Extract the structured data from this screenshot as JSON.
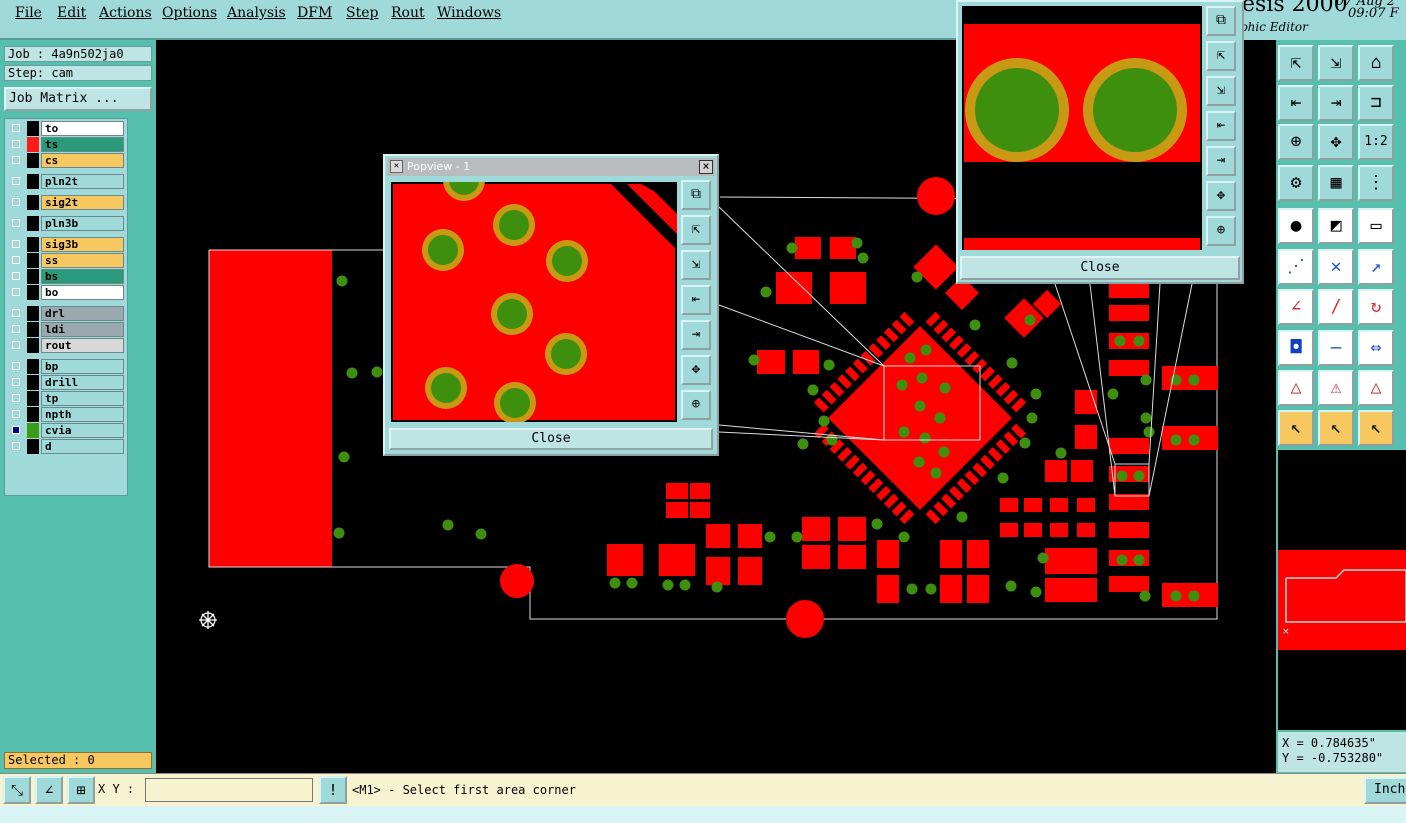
{
  "menubar": {
    "items": [
      "File",
      "Edit",
      "Actions",
      "Options",
      "Analysis",
      "DFM",
      "Step",
      "Rout",
      "Windows"
    ]
  },
  "header": {
    "app_title_fragment": "esis 2000",
    "subtitle_fragment": "phic Editor",
    "date_fragment": "07 Aug 2",
    "time_fragment": "09:07 F"
  },
  "job": {
    "job_line": "Job : 4a9n502ja0",
    "step_line": "Step: cam",
    "matrix_button": "Job Matrix ..."
  },
  "layers": [
    {
      "name": "to",
      "color": "#ffffff",
      "swatch": "#000000"
    },
    {
      "name": "ts",
      "color": "#2a9a7a",
      "swatch": "#ff1a1a"
    },
    {
      "name": "cs",
      "color": "#f7c860",
      "swatch": "#000000"
    },
    {
      "name": "pln2t",
      "color": "#9fd9d9",
      "swatch": "#000000"
    },
    {
      "name": "sig2t",
      "color": "#f7c860",
      "swatch": "#000000"
    },
    {
      "name": "pln3b",
      "color": "#9fd9d9",
      "swatch": "#000000"
    },
    {
      "name": "sig3b",
      "color": "#f7c860",
      "swatch": "#000000"
    },
    {
      "name": "ss",
      "color": "#f7c860",
      "swatch": "#000000"
    },
    {
      "name": "bs",
      "color": "#2a9a7a",
      "swatch": "#000000"
    },
    {
      "name": "bo",
      "color": "#ffffff",
      "swatch": "#000000"
    },
    {
      "name": "drl",
      "color": "#9aa8b0",
      "swatch": "#000000"
    },
    {
      "name": "ldi",
      "color": "#9aa8b0",
      "swatch": "#000000"
    },
    {
      "name": "rout",
      "color": "#d8d8d8",
      "swatch": "#000000"
    },
    {
      "name": "bp",
      "color": "#9fd9d9",
      "swatch": "#000000"
    },
    {
      "name": "drill",
      "color": "#9fd9d9",
      "swatch": "#000000"
    },
    {
      "name": "tp",
      "color": "#9fd9d9",
      "swatch": "#000000"
    },
    {
      "name": "npth",
      "color": "#9fd9d9",
      "swatch": "#000000"
    },
    {
      "name": "cvia",
      "color": "#9fd9d9",
      "swatch": "#3a9a1a"
    },
    {
      "name": "d",
      "color": "#9fd9d9",
      "swatch": "#000000"
    }
  ],
  "selected": "Selected : 0",
  "popview": {
    "title": "Popview - 1",
    "close_label": "Close"
  },
  "popview2": {
    "close_label": "Close"
  },
  "coords": {
    "x": "X = 0.784635\"",
    "y": "Y = -0.753280\""
  },
  "bottom": {
    "xy_label": "X Y :",
    "xy_value": "",
    "status": "<M1> - Select first area corner",
    "units": "Inch"
  },
  "colors": {
    "copper": "#ff0000",
    "via_fill": "#3f8f0f",
    "via_ring": "#c89a14",
    "panel_teal": "#57bfae",
    "button_cyan": "#9fd9d9"
  }
}
